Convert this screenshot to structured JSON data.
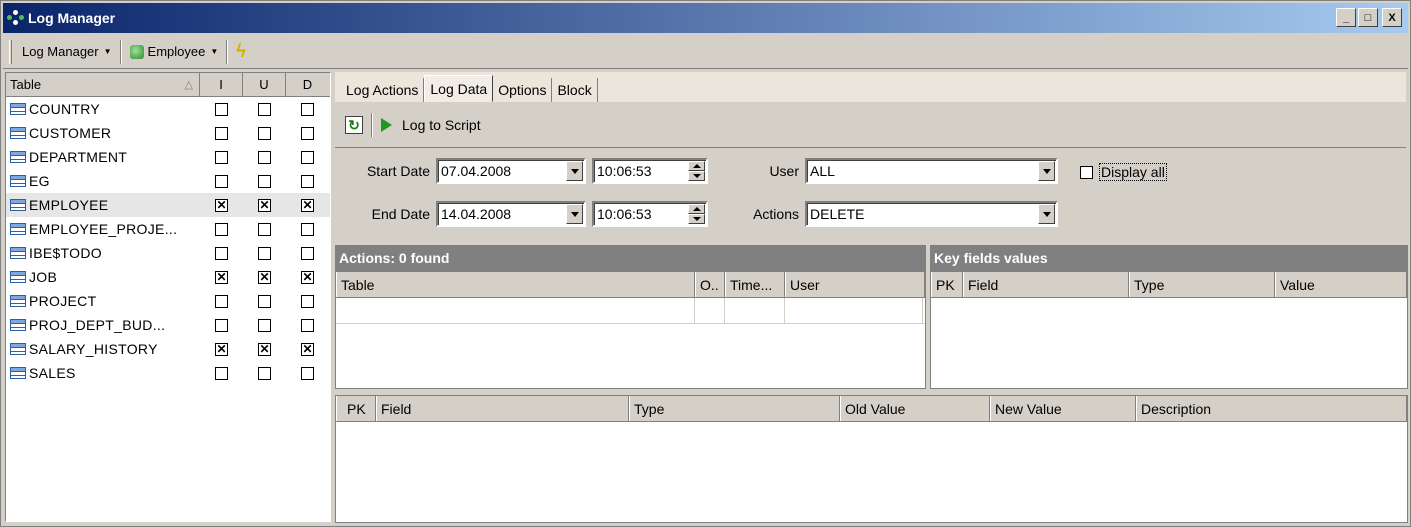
{
  "window": {
    "title": "Log Manager",
    "buttons": {
      "minimize": "_",
      "maximize": "□",
      "close": "X"
    }
  },
  "toolbar": {
    "log_manager_label": "Log Manager",
    "database_label": "Employee"
  },
  "table_list": {
    "headers": {
      "table": "Table",
      "i": "I",
      "u": "U",
      "d": "D"
    },
    "rows": [
      {
        "name": "COUNTRY",
        "i": false,
        "u": false,
        "d": false
      },
      {
        "name": "CUSTOMER",
        "i": false,
        "u": false,
        "d": false
      },
      {
        "name": "DEPARTMENT",
        "i": false,
        "u": false,
        "d": false
      },
      {
        "name": "EG",
        "i": false,
        "u": false,
        "d": false
      },
      {
        "name": "EMPLOYEE",
        "i": true,
        "u": true,
        "d": true,
        "selected": true
      },
      {
        "name": "EMPLOYEE_PROJE...",
        "i": false,
        "u": false,
        "d": false
      },
      {
        "name": "IBE$TODO",
        "i": false,
        "u": false,
        "d": false
      },
      {
        "name": "JOB",
        "i": true,
        "u": true,
        "d": true
      },
      {
        "name": "PROJECT",
        "i": false,
        "u": false,
        "d": false
      },
      {
        "name": "PROJ_DEPT_BUD...",
        "i": false,
        "u": false,
        "d": false
      },
      {
        "name": "SALARY_HISTORY",
        "i": true,
        "u": true,
        "d": true
      },
      {
        "name": "SALES",
        "i": false,
        "u": false,
        "d": false
      }
    ]
  },
  "tabs": [
    {
      "label": "Log Actions",
      "active": false
    },
    {
      "label": "Log Data",
      "active": true
    },
    {
      "label": "Options",
      "active": false
    },
    {
      "label": "Block",
      "active": false
    }
  ],
  "actions_bar": {
    "log_to_script": "Log to Script"
  },
  "filters": {
    "start_date_label": "Start Date",
    "start_date": "07.04.2008",
    "start_time": "10:06:53",
    "end_date_label": "End Date",
    "end_date": "14.04.2008",
    "end_time": "10:06:53",
    "user_label": "User",
    "user_value": "ALL",
    "actions_label": "Actions",
    "actions_value": "DELETE",
    "display_all_label": "Display all",
    "display_all_checked": false
  },
  "actions_panel": {
    "title": "Actions: 0 found",
    "columns": [
      "Table",
      "O..",
      "Time...",
      "User"
    ]
  },
  "key_fields_panel": {
    "title": "Key fields values",
    "columns": [
      "PK",
      "Field",
      "Type",
      "Value"
    ]
  },
  "details_grid": {
    "columns": [
      "PK",
      "Field",
      "Type",
      "Old Value",
      "New Value",
      "Description"
    ]
  }
}
